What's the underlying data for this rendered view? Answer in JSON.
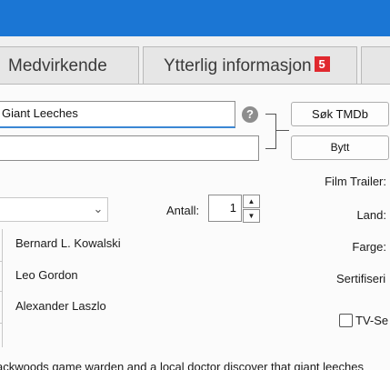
{
  "tabs": [
    {
      "label": "Medvirkende"
    },
    {
      "label": "Ytterlig informasjon",
      "badge": "5"
    },
    {
      "label": ""
    }
  ],
  "title_field": {
    "value": "Giant Leeches"
  },
  "second_field": {
    "value": ""
  },
  "help_icon": "?",
  "buttons": {
    "search_tmdb": "Søk TMDb",
    "swap": "Bytt"
  },
  "right_labels": {
    "film_trailer": "Film Trailer:",
    "country": "Land:",
    "color": "Farge:",
    "certification": "Sertifiseri",
    "tv_series": "TV-Se"
  },
  "count": {
    "label": "Antall:",
    "value": "1"
  },
  "cast": [
    "Bernard L. Kowalski",
    "Leo Gordon",
    "Alexander Laszlo"
  ],
  "synopsis": "ackwoods game warden and a local doctor discover that giant leeches",
  "colors": {
    "titlebar": "#1b76d4",
    "badge": "#e0282e",
    "focus": "#3b87d4"
  }
}
